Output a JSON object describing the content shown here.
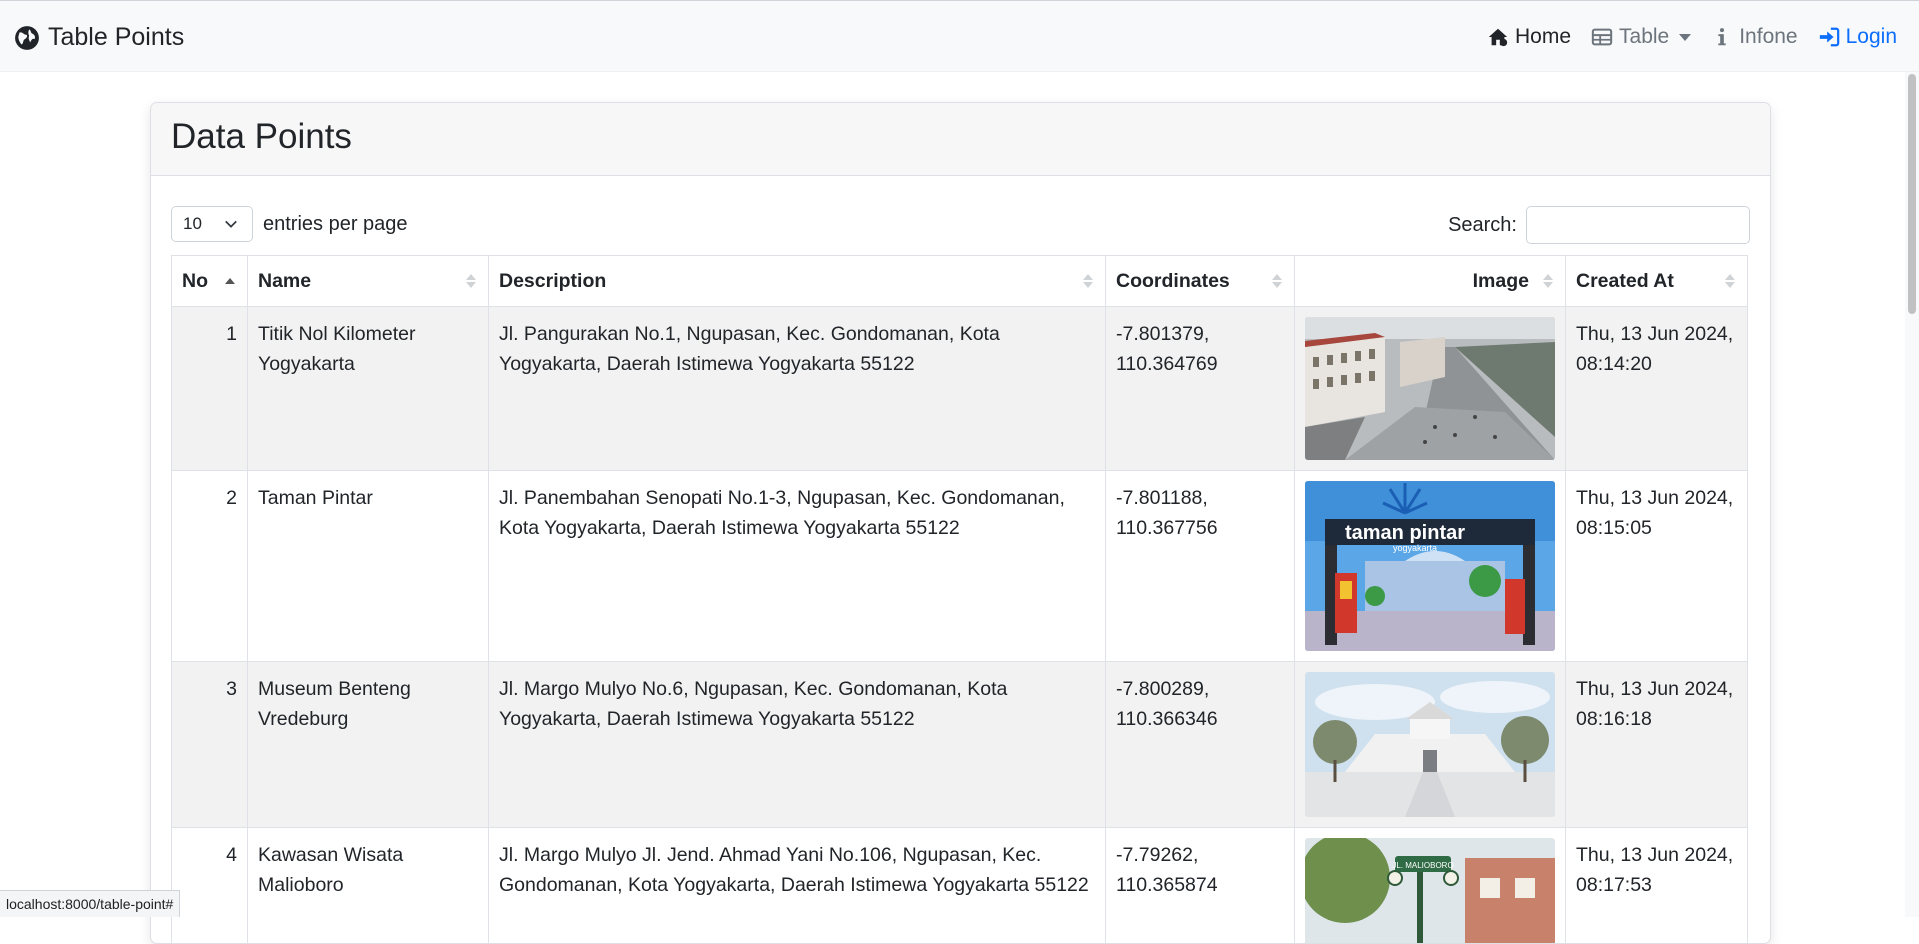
{
  "navbar": {
    "brand": "Table Points",
    "home": "Home",
    "table": "Table",
    "info": "Infone",
    "login": "Login"
  },
  "card": {
    "title": "Data Points"
  },
  "controls": {
    "page_size": "10",
    "entries_label": "entries per page",
    "search_label": "Search:",
    "search_value": ""
  },
  "table": {
    "headers": [
      "No",
      "Name",
      "Description",
      "Coordinates",
      "Image",
      "Created At"
    ],
    "rows": [
      {
        "no": "1",
        "name": "Titik Nol Kilometer Yogyakarta",
        "description": "Jl. Pangurakan No.1, Ngupasan, Kec. Gondomanan, Kota Yogyakarta, Daerah Istimewa Yogyakarta 55122",
        "coord_lat": "-7.801379,",
        "coord_lng": "110.364769",
        "created_date": "Thu, 13 Jun 2024,",
        "created_time": "08:14:20"
      },
      {
        "no": "2",
        "name": "Taman Pintar",
        "description": "Jl. Panembahan Senopati No.1-3, Ngupasan, Kec. Gondomanan, Kota Yogyakarta, Daerah Istimewa Yogyakarta 55122",
        "coord_lat": "-7.801188,",
        "coord_lng": "110.367756",
        "created_date": "Thu, 13 Jun 2024,",
        "created_time": "08:15:05",
        "image_sign": "taman pintar",
        "image_subsign": "yogyakarta"
      },
      {
        "no": "3",
        "name": "Museum Benteng Vredeburg",
        "description": "Jl. Margo Mulyo No.6, Ngupasan, Kec. Gondomanan, Kota Yogyakarta, Daerah Istimewa Yogyakarta 55122",
        "coord_lat": "-7.800289,",
        "coord_lng": "110.366346",
        "created_date": "Thu, 13 Jun 2024,",
        "created_time": "08:16:18"
      },
      {
        "no": "4",
        "name": "Kawasan Wisata Malioboro",
        "description": "Jl. Margo Mulyo Jl. Jend. Ahmad Yani No.106, Ngupasan, Kec. Gondomanan, Kota Yogyakarta, Daerah Istimewa Yogyakarta 55122",
        "coord_lat": "-7.79262,",
        "coord_lng": "110.365874",
        "created_date": "Thu, 13 Jun 2024,",
        "created_time": "08:17:53",
        "image_sign": "JL. MALIOBORO"
      }
    ]
  },
  "status_bar": {
    "url": "localhost:8000/table-point#"
  },
  "colors": {
    "accent": "#0d6efd",
    "navbar_bg": "#f8f9fa",
    "stripe": "#f2f2f2"
  },
  "icons": [
    "globe-icon",
    "home-icon",
    "table-icon",
    "info-icon",
    "login-icon",
    "chevron-down-icon",
    "sort-icon"
  ]
}
